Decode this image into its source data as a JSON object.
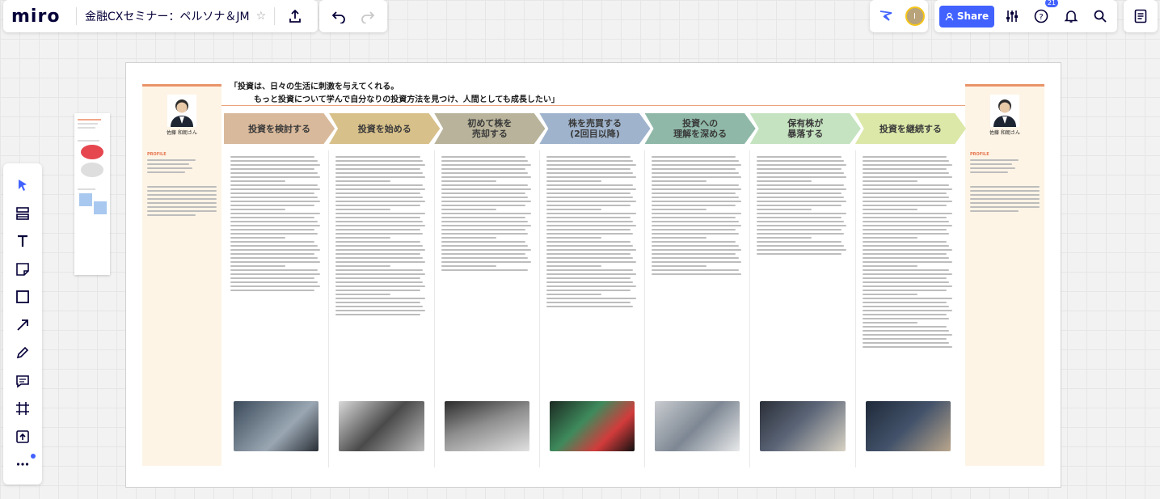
{
  "app": {
    "logo": "miro",
    "board_title": "金融CXセミナー：ペルソナ＆JM",
    "share_label": "Share",
    "avatar_initial": "I",
    "help_badge": "21"
  },
  "left_tools": [
    {
      "name": "select-tool",
      "icon": "cursor-icon"
    },
    {
      "name": "templates-tool",
      "icon": "templates-icon"
    },
    {
      "name": "text-tool",
      "icon": "text-icon"
    },
    {
      "name": "sticky-note-tool",
      "icon": "sticky-note-icon"
    },
    {
      "name": "shape-tool",
      "icon": "square-icon"
    },
    {
      "name": "line-tool",
      "icon": "arrow-icon"
    },
    {
      "name": "pen-tool",
      "icon": "pen-icon"
    },
    {
      "name": "comment-tool",
      "icon": "comment-icon"
    },
    {
      "name": "frame-tool",
      "icon": "frame-icon"
    },
    {
      "name": "upload-tool",
      "icon": "upload-icon"
    },
    {
      "name": "more-tools",
      "icon": "more-icon"
    }
  ],
  "journey": {
    "quote_line1": "「投資は、日々の生活に刺激を与えてくれる。",
    "quote_line2": "もっと投資について学んで自分なりの投資方法を見つけ、人間としても成長したい」",
    "persona_left": {
      "name": "佐藤 和朗さん",
      "profile_heading": "PROFILE"
    },
    "persona_right": {
      "name": "佐藤 和朗さん",
      "profile_heading": "PROFILE"
    },
    "stages": [
      {
        "label": "投資を検討する",
        "color": "#d9b99b"
      },
      {
        "label": "投資を始める",
        "color": "#d8c08a"
      },
      {
        "label": "初めて株を\n売却する",
        "color": "#b8b39a"
      },
      {
        "label": "株を売買する\n(2回目以降)",
        "color": "#9fb3cc"
      },
      {
        "label": "投資への\n理解を深める",
        "color": "#8fb8a8"
      },
      {
        "label": "保有株が\n暴落する",
        "color": "#c5e3c0"
      },
      {
        "label": "投資を継続する",
        "color": "#dbe8a8"
      }
    ],
    "colors": {
      "accent": "#e9946a",
      "persona_bg": "#fdf4e6",
      "brand": "#4262ff"
    }
  }
}
